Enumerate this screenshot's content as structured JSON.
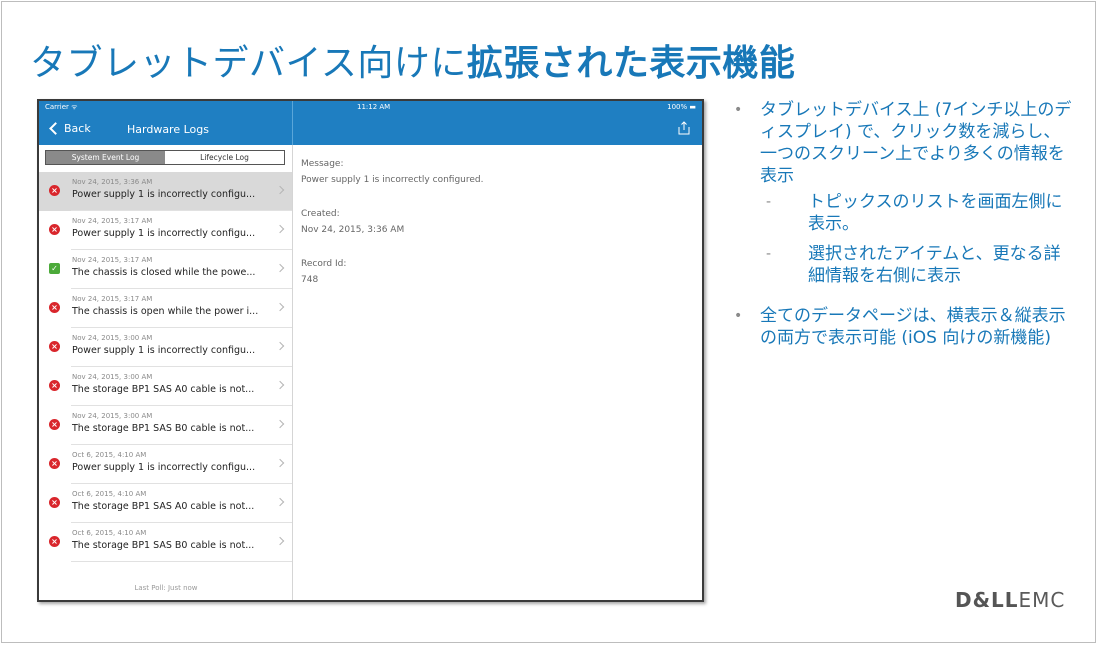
{
  "slide": {
    "title_regular": "タブレットデバイス向けに",
    "title_bold": "拡張された表示機能",
    "logo": {
      "dell": "D&LL",
      "emc": "EMC"
    }
  },
  "tablet": {
    "status": {
      "carrier": "Carrier ᯤ",
      "time": "11:12 AM",
      "battery": "100% ▬"
    },
    "nav": {
      "back_label": "Back",
      "title": "Hardware Logs",
      "share_icon": "share-icon"
    },
    "segments": {
      "system": "System Event Log",
      "lifecycle": "Lifecycle Log"
    },
    "logs": [
      {
        "status": "error",
        "date": "Nov 24, 2015, 3:36 AM",
        "message": "Power supply 1 is incorrectly configu..."
      },
      {
        "status": "error",
        "date": "Nov 24, 2015, 3:17 AM",
        "message": "Power supply 1 is incorrectly configu..."
      },
      {
        "status": "ok",
        "date": "Nov 24, 2015, 3:17 AM",
        "message": "The chassis is closed while the powe..."
      },
      {
        "status": "error",
        "date": "Nov 24, 2015, 3:17 AM",
        "message": "The chassis is open while the power i..."
      },
      {
        "status": "error",
        "date": "Nov 24, 2015, 3:00 AM",
        "message": "Power supply 1 is incorrectly configu..."
      },
      {
        "status": "error",
        "date": "Nov 24, 2015, 3:00 AM",
        "message": "The storage BP1 SAS A0 cable is not..."
      },
      {
        "status": "error",
        "date": "Nov 24, 2015, 3:00 AM",
        "message": "The storage BP1 SAS B0 cable is not..."
      },
      {
        "status": "error",
        "date": "Oct 6, 2015, 4:10 AM",
        "message": "Power supply 1 is incorrectly configu..."
      },
      {
        "status": "error",
        "date": "Oct 6, 2015, 4:10 AM",
        "message": "The storage BP1 SAS A0 cable is not..."
      },
      {
        "status": "error",
        "date": "Oct 6, 2015, 4:10 AM",
        "message": "The storage BP1 SAS B0 cable is not..."
      }
    ],
    "last_poll": "Last Poll: Just now",
    "detail": {
      "message_label": "Message:",
      "message_value": "Power supply 1 is incorrectly configured.",
      "created_label": "Created:",
      "created_value": "Nov 24, 2015, 3:36 AM",
      "record_label": "Record Id:",
      "record_value": "748"
    }
  },
  "bullets": {
    "b1": "タブレットデバイス上 (7インチ以上のディスプレイ) で、クリック数を減らし、一つのスクリーン上でより多くの情報を表示",
    "b1_sub1": "トピックスのリストを画面左側に表示。",
    "b1_sub2": "選択されたアイテムと、更なる詳細情報を右側に表示",
    "b2": "全てのデータページは、横表示＆縦表示の両方で表示可能 (iOS 向けの新機能)"
  }
}
